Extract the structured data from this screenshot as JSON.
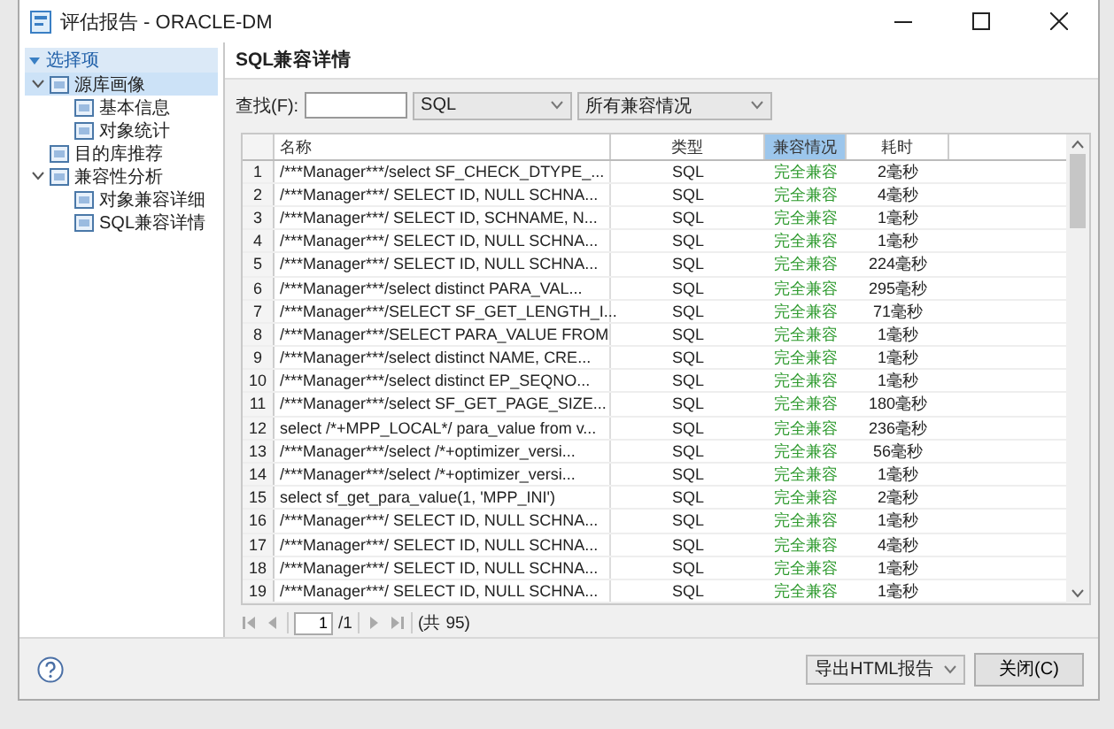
{
  "window": {
    "title": "评估报告 - ORACLE-DM"
  },
  "sidebar": {
    "header": "选择项",
    "expanded": true,
    "items": [
      {
        "label": "源库画像",
        "expanded": true,
        "selected": true,
        "children": [
          {
            "label": "基本信息",
            "selected": false
          },
          {
            "label": "对象统计",
            "selected": false
          }
        ]
      },
      {
        "label": "目的库推荐",
        "selected": false
      },
      {
        "label": "兼容性分析",
        "expanded": true,
        "selected": false,
        "children": [
          {
            "label": "对象兼容详细",
            "selected": false
          },
          {
            "label": "SQL兼容详情",
            "selected": false
          }
        ]
      }
    ]
  },
  "panel_title": "SQL兼容详情",
  "search": {
    "label": "查找(F):"
  },
  "filters": [
    {
      "value": "SQL"
    },
    {
      "value": "所有兼容情况"
    }
  ],
  "table": {
    "columns": [
      {
        "label": "名称",
        "sorted": false
      },
      {
        "label": "类型",
        "sorted": false
      },
      {
        "label": "兼容情况",
        "sorted": true
      },
      {
        "label": "耗时",
        "sorted": false
      }
    ],
    "rows": [
      {
        "index": "1",
        "name": "/***Manager***/select SF_CHECK_DTYPE_...",
        "type": "SQL",
        "status": "完全兼容",
        "time": "2毫秒"
      },
      {
        "index": "2",
        "name": "/***Manager***/ SELECT  ID, NULL SCHNA...",
        "type": "SQL",
        "status": "完全兼容",
        "time": "4毫秒"
      },
      {
        "index": "3",
        "name": "/***Manager***/ SELECT  ID, SCHNAME, N...",
        "type": "SQL",
        "status": "完全兼容",
        "time": "1毫秒"
      },
      {
        "index": "4",
        "name": "/***Manager***/ SELECT  ID, NULL SCHNA...",
        "type": "SQL",
        "status": "完全兼容",
        "time": "1毫秒"
      },
      {
        "index": "5",
        "name": "/***Manager***/ SELECT  ID, NULL SCHNA...",
        "type": "SQL",
        "status": "完全兼容",
        "time": "224毫秒"
      },
      {
        "index": "6",
        "name": "/***Manager***/select distinct PARA_VAL...",
        "type": "SQL",
        "status": "完全兼容",
        "time": "295毫秒"
      },
      {
        "index": "7",
        "name": "/***Manager***/SELECT SF_GET_LENGTH_I...",
        "type": "SQL",
        "status": "完全兼容",
        "time": "71毫秒"
      },
      {
        "index": "8",
        "name": "/***Manager***/SELECT PARA_VALUE FROM",
        "type": "SQL",
        "status": "完全兼容",
        "time": "1毫秒"
      },
      {
        "index": "9",
        "name": "/***Manager***/select distinct NAME, CRE...",
        "type": "SQL",
        "status": "完全兼容",
        "time": "1毫秒"
      },
      {
        "index": "10",
        "name": "/***Manager***/select distinct EP_SEQNO...",
        "type": "SQL",
        "status": "完全兼容",
        "time": "1毫秒"
      },
      {
        "index": "11",
        "name": "/***Manager***/select SF_GET_PAGE_SIZE...",
        "type": "SQL",
        "status": "完全兼容",
        "time": "180毫秒"
      },
      {
        "index": "12",
        "name": "select /*+MPP_LOCAL*/ para_value from v...",
        "type": "SQL",
        "status": "完全兼容",
        "time": "236毫秒"
      },
      {
        "index": "13",
        "name": "/***Manager***/select /*+optimizer_versi...",
        "type": "SQL",
        "status": "完全兼容",
        "time": "56毫秒"
      },
      {
        "index": "14",
        "name": "/***Manager***/select /*+optimizer_versi...",
        "type": "SQL",
        "status": "完全兼容",
        "time": "1毫秒"
      },
      {
        "index": "15",
        "name": "select sf_get_para_value(1, 'MPP_INI')",
        "type": "SQL",
        "status": "完全兼容",
        "time": "2毫秒"
      },
      {
        "index": "16",
        "name": "/***Manager***/ SELECT  ID, NULL SCHNA...",
        "type": "SQL",
        "status": "完全兼容",
        "time": "1毫秒"
      },
      {
        "index": "17",
        "name": "/***Manager***/ SELECT  ID, NULL SCHNA...",
        "type": "SQL",
        "status": "完全兼容",
        "time": "4毫秒"
      },
      {
        "index": "18",
        "name": "/***Manager***/ SELECT  ID, NULL SCHNA...",
        "type": "SQL",
        "status": "完全兼容",
        "time": "1毫秒"
      },
      {
        "index": "19",
        "name": "/***Manager***/ SELECT  ID, NULL SCHNA...",
        "type": "SQL",
        "status": "完全兼容",
        "time": "1毫秒"
      }
    ]
  },
  "pager": {
    "page": "1",
    "pages": "/1",
    "total": "(共 95)"
  },
  "footer": {
    "export": "导出HTML报告",
    "close": "关闭(C)"
  }
}
